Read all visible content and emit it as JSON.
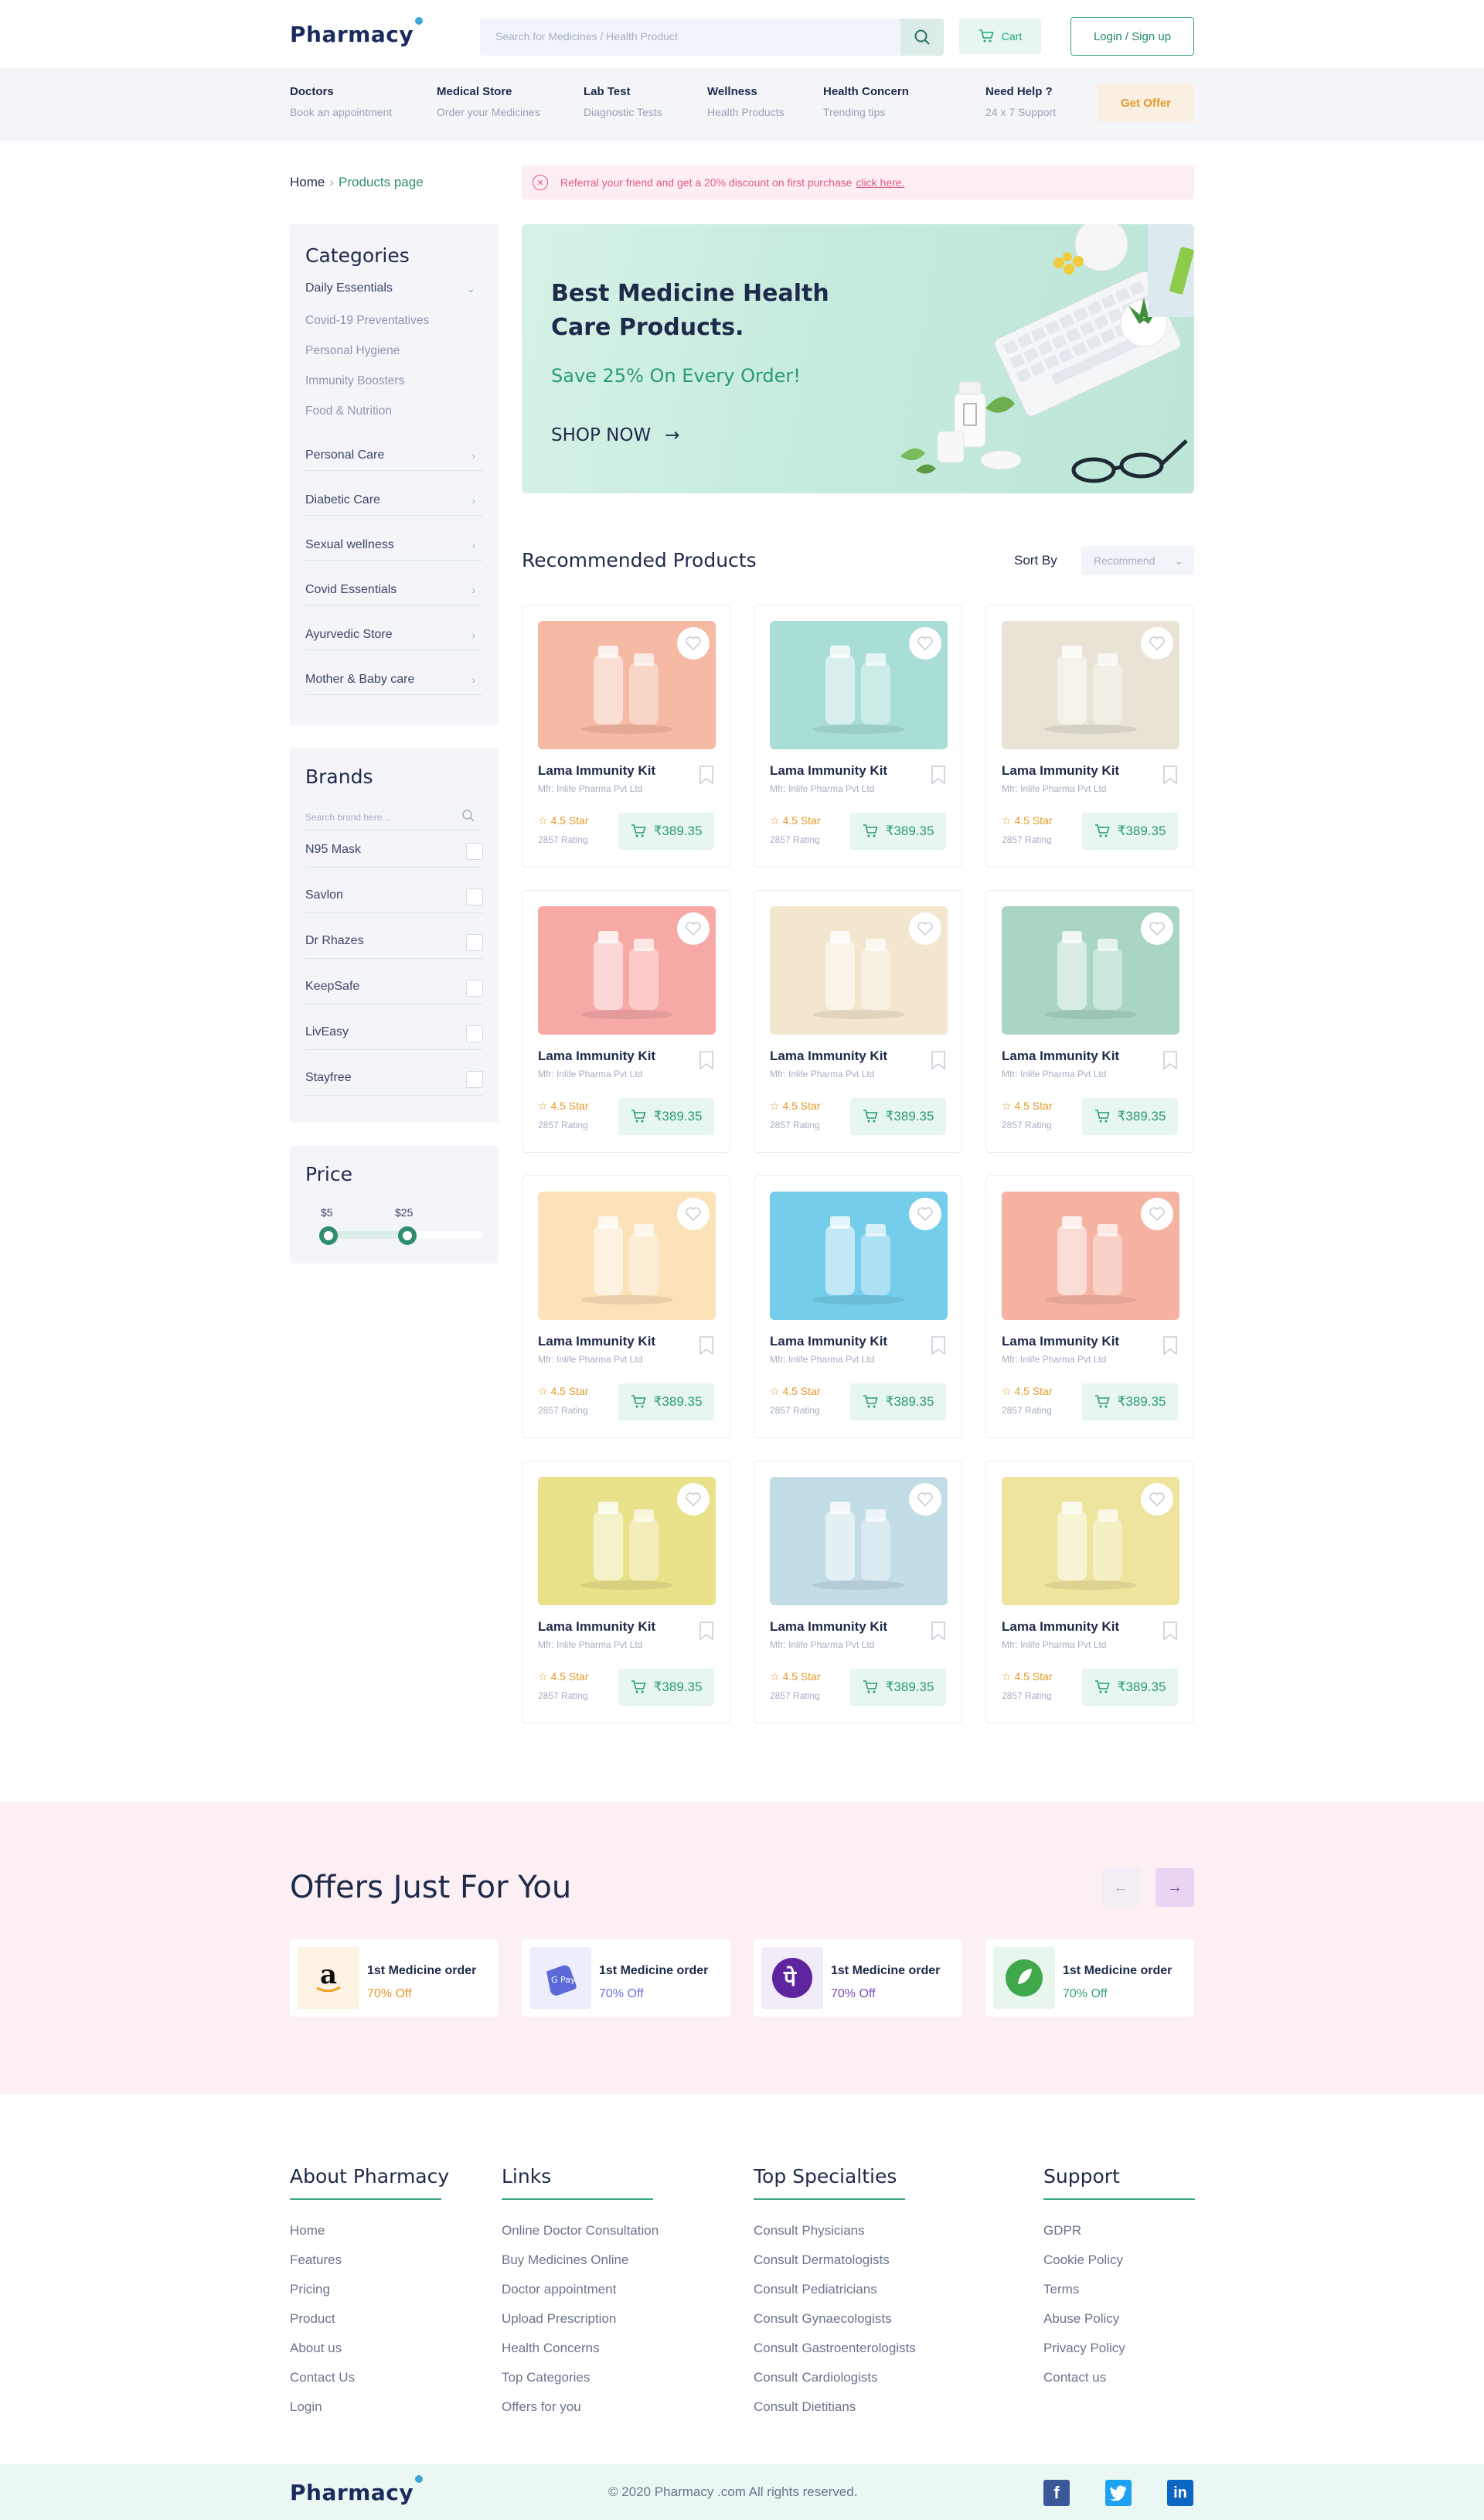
{
  "header": {
    "logo": "Pharmacy",
    "search_placeholder": "Search for Medicines / Health Product",
    "cart_label": "Cart",
    "login_label": "Login / Sign up"
  },
  "nav": {
    "items": [
      {
        "title": "Doctors",
        "sub": "Book an appointment"
      },
      {
        "title": "Medical Store",
        "sub": "Order your Medicines"
      },
      {
        "title": "Lab Test",
        "sub": "Diagnostic Tests"
      },
      {
        "title": "Wellness",
        "sub": "Health Products"
      },
      {
        "title": "Health Concern",
        "sub": "Trending tips"
      },
      {
        "title": "Need Help ?",
        "sub": "24 x 7 Support"
      }
    ],
    "offer_button": "Get Offer"
  },
  "breadcrumb": {
    "home": "Home",
    "current": "Products page"
  },
  "referral": {
    "text": "Referral your friend and get a 20% discount on first purchase",
    "link": "click here."
  },
  "categories": {
    "title": "Categories",
    "open_item": "Daily Essentials",
    "sub_items": [
      "Covid-19 Preventatives",
      "Personal Hygiene",
      "Immunity Boosters",
      "Food & Nutrition"
    ],
    "items": [
      "Personal Care",
      "Diabetic Care",
      "Sexual wellness",
      "Covid Essentials",
      "Ayurvedic Store",
      "Mother & Baby care"
    ]
  },
  "brands": {
    "title": "Brands",
    "search_placeholder": "Search brand here...",
    "items": [
      "N95 Mask",
      "Savlon",
      "Dr Rhazes",
      "KeepSafe",
      "LivEasy",
      "Stayfree"
    ]
  },
  "price": {
    "title": "Price",
    "min": "$5",
    "max": "$25"
  },
  "hero": {
    "title": "Best Medicine Health Care Products.",
    "save": "Save 25% On Every Order!",
    "cta": "SHOP NOW"
  },
  "products": {
    "title": "Recommended Products",
    "sort_label": "Sort By",
    "sort_value": "Recommend",
    "items": [
      {
        "name": "Lama Immunity Kit",
        "mfr": "Mfr: Inlife Pharma Pvt Ltd",
        "rating": "4.5 Star",
        "rating_count": "2857 Rating",
        "price": "₹389.35",
        "bg": "#f6b9a3"
      },
      {
        "name": "Lama Immunity Kit",
        "mfr": "Mfr: Inlife Pharma Pvt Ltd",
        "rating": "4.5 Star",
        "rating_count": "2857 Rating",
        "price": "₹389.35",
        "bg": "#a9ded7"
      },
      {
        "name": "Lama Immunity Kit",
        "mfr": "Mfr: Inlife Pharma Pvt Ltd",
        "rating": "4.5 Star",
        "rating_count": "2857 Rating",
        "price": "₹389.35",
        "bg": "#e9e3d6"
      },
      {
        "name": "Lama Immunity Kit",
        "mfr": "Mfr: Inlife Pharma Pvt Ltd",
        "rating": "4.5 Star",
        "rating_count": "2857 Rating",
        "price": "₹389.35",
        "bg": "#f7a9a6"
      },
      {
        "name": "Lama Immunity Kit",
        "mfr": "Mfr: Inlife Pharma Pvt Ltd",
        "rating": "4.5 Star",
        "rating_count": "2857 Rating",
        "price": "₹389.35",
        "bg": "#f3e6cf"
      },
      {
        "name": "Lama Immunity Kit",
        "mfr": "Mfr: Inlife Pharma Pvt Ltd",
        "rating": "4.5 Star",
        "rating_count": "2857 Rating",
        "price": "₹389.35",
        "bg": "#a9d6c2"
      },
      {
        "name": "Lama Immunity Kit",
        "mfr": "Mfr: Inlife Pharma Pvt Ltd",
        "rating": "4.5 Star",
        "rating_count": "2857 Rating",
        "price": "₹389.35",
        "bg": "#fbe2b8"
      },
      {
        "name": "Lama Immunity Kit",
        "mfr": "Mfr: Inlife Pharma Pvt Ltd",
        "rating": "4.5 Star",
        "rating_count": "2857 Rating",
        "price": "₹389.35",
        "bg": "#74cdea"
      },
      {
        "name": "Lama Immunity Kit",
        "mfr": "Mfr: Inlife Pharma Pvt Ltd",
        "rating": "4.5 Star",
        "rating_count": "2857 Rating",
        "price": "₹389.35",
        "bg": "#f7b3a2"
      },
      {
        "name": "Lama Immunity Kit",
        "mfr": "Mfr: Inlife Pharma Pvt Ltd",
        "rating": "4.5 Star",
        "rating_count": "2857 Rating",
        "price": "₹389.35",
        "bg": "#e9e28a"
      },
      {
        "name": "Lama Immunity Kit",
        "mfr": "Mfr: Inlife Pharma Pvt Ltd",
        "rating": "4.5 Star",
        "rating_count": "2857 Rating",
        "price": "₹389.35",
        "bg": "#c2dde6"
      },
      {
        "name": "Lama Immunity Kit",
        "mfr": "Mfr: Inlife Pharma Pvt Ltd",
        "rating": "4.5 Star",
        "rating_count": "2857 Rating",
        "price": "₹389.35",
        "bg": "#efe49e"
      }
    ]
  },
  "offers": {
    "title": "Offers Just For You",
    "items": [
      {
        "name": "1st Medicine order",
        "pct": "70% Off",
        "color": "#e39b2b",
        "logo_bg": "#fdf3e4"
      },
      {
        "name": "1st Medicine order",
        "pct": "70% Off",
        "color": "#6a76d8",
        "logo_bg": "#eceefc"
      },
      {
        "name": "1st Medicine order",
        "pct": "70% Off",
        "color": "#7a4fb6",
        "logo_bg": "#f2ecf9"
      },
      {
        "name": "1st Medicine order",
        "pct": "70% Off",
        "color": "#36a472",
        "logo_bg": "#e8f6ee"
      }
    ]
  },
  "footer": {
    "columns": [
      {
        "title": "About Pharmacy",
        "links": [
          "Home",
          "Features",
          "Pricing",
          "Product",
          "About us",
          "Contact Us",
          "Login"
        ]
      },
      {
        "title": "Links",
        "links": [
          "Online Doctor Consultation",
          "Buy Medicines Online",
          "Doctor appointment",
          "Upload Prescription",
          "Health Concerns",
          "Top Categories",
          "Offers for you"
        ]
      },
      {
        "title": "Top Specialties",
        "links": [
          "Consult Physicians",
          "Consult Dermatologists",
          "Consult Pediatricians",
          "Consult Gynaecologists",
          "Consult Gastroenterologists",
          "Consult Cardiologists",
          "Consult Dietitians"
        ]
      },
      {
        "title": "Support",
        "links": [
          "GDPR",
          "Cookie Policy",
          "Terms",
          "Abuse Policy",
          "Privacy Policy",
          "Contact us"
        ]
      }
    ],
    "logo": "Pharmacy",
    "copyright": "© 2020 Pharmacy .com All rights reserved.",
    "social": [
      {
        "name": "facebook-icon",
        "glyph": "f",
        "color": "#3b5998"
      },
      {
        "name": "twitter-icon",
        "glyph": "t",
        "color": "#1da1f2"
      },
      {
        "name": "linkedin-icon",
        "glyph": "in",
        "color": "#0a66c2"
      }
    ]
  },
  "colors": {
    "primary": "#2f8e70",
    "accent_pink": "#dd5a85",
    "accent_orange": "#e39b2b",
    "navy": "#1e2a4a"
  }
}
